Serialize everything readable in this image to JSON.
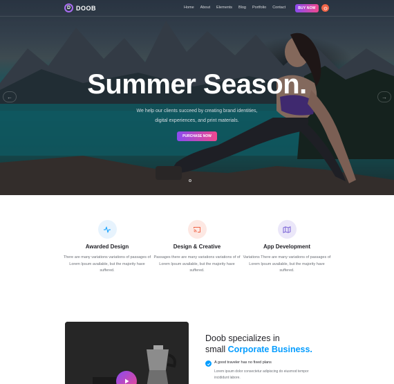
{
  "nav": {
    "logo_text": "DOOB",
    "logo_mark": "D",
    "items": [
      "Home",
      "About",
      "Elements",
      "Blog",
      "Portfolio",
      "Contact"
    ],
    "buy_label": "BUY NOW",
    "power_icon": "power-icon"
  },
  "hero": {
    "title": "Summer Season.",
    "subtitle_line1": "We help our clients succeed by creating brand identities,",
    "subtitle_line2": "digital experiences, and print materials.",
    "button_label": "PURCHASE NOW",
    "prev_arrow": "←",
    "next_arrow": "→"
  },
  "features": [
    {
      "icon": "activity-icon",
      "title": "Awarded Design",
      "desc": "There are many variations variations of passages of Lorem Ipsum available, but the majority have suffered."
    },
    {
      "icon": "cast-icon",
      "title": "Design & Creative",
      "desc": "Passages there are many variations variations of of Lorem Ipsum available, but the majority have suffered."
    },
    {
      "icon": "map-icon",
      "title": "App Development",
      "desc": "Variations There are many variations of passages of Lorem Ipsum available, but the majority have suffered."
    }
  ],
  "about": {
    "title_part1": "Doob specializes in",
    "title_part2": "small ",
    "title_highlight": "Corporate Business.",
    "list_title": "A good traveler has no fixed plans",
    "list_desc": "Lorem ipsum dolor consectetur adipiscing do eiusmod tempor incididunt labore."
  },
  "colors": {
    "accent_gradient_start": "#8a4bf0",
    "accent_gradient_end": "#f0488d",
    "highlight_blue": "#059dff"
  }
}
